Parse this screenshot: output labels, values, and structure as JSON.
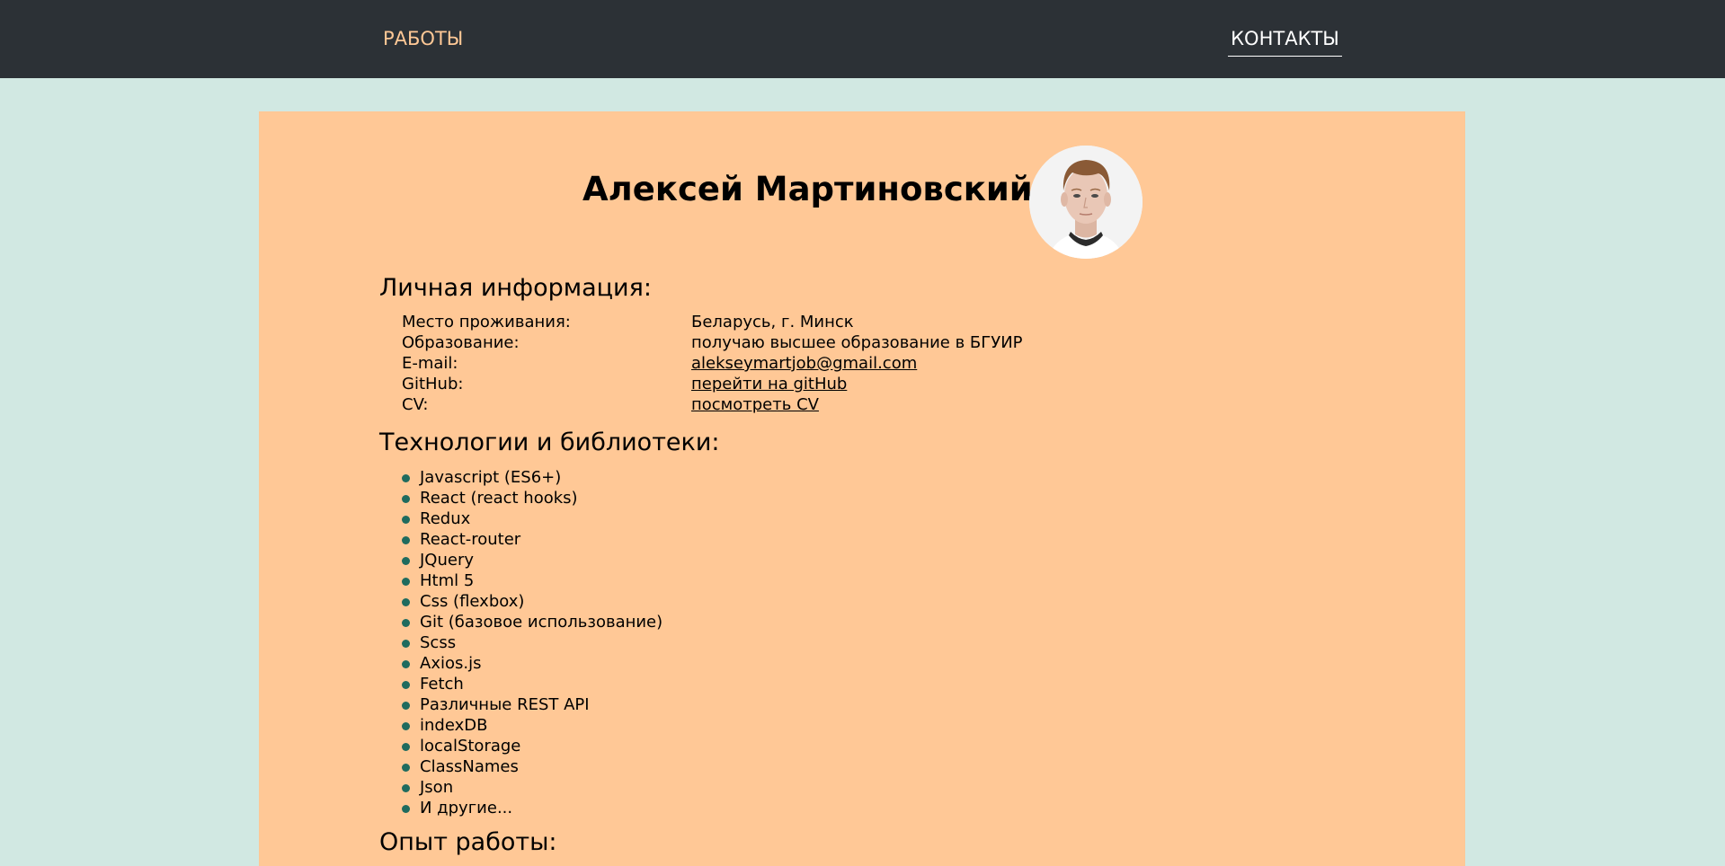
{
  "nav": {
    "works": "РАБОТЫ",
    "contacts": "КОНТАКТЫ"
  },
  "profile": {
    "name": "Алексей Мартиновский"
  },
  "personal": {
    "title": "Личная информация:",
    "rows": [
      {
        "label": "Место проживания:",
        "value": "Беларусь, г. Минск"
      },
      {
        "label": "Образование:",
        "value": "получаю высшее образование в БГУИР"
      },
      {
        "label": "E-mail:",
        "value": "alekseymartjob@gmail.com"
      },
      {
        "label": "GitHub:",
        "value": "перейти на gitHub"
      },
      {
        "label": "CV:",
        "value": "посмотреть CV"
      }
    ]
  },
  "tech": {
    "title": "Технологии и библиотеки:",
    "items": [
      "Javascript (ES6+)",
      "React (react hooks)",
      "Redux",
      "React-router",
      "JQuery",
      "Html 5",
      "Css (flexbox)",
      "Git (базовое использование)",
      "Scss",
      "Axios.js",
      "Fetch",
      "Различные REST API",
      "indexDB",
      "localStorage",
      "ClassNames",
      "Json",
      "И другие..."
    ]
  },
  "experience": {
    "title": "Опыт работы:"
  },
  "colors": {
    "page_bg": "#d1e8e2",
    "nav_bg": "#2c3136",
    "nav_works": "#ffc896",
    "card_bg": "#ffc896",
    "bullet": "#1f6b5e"
  }
}
